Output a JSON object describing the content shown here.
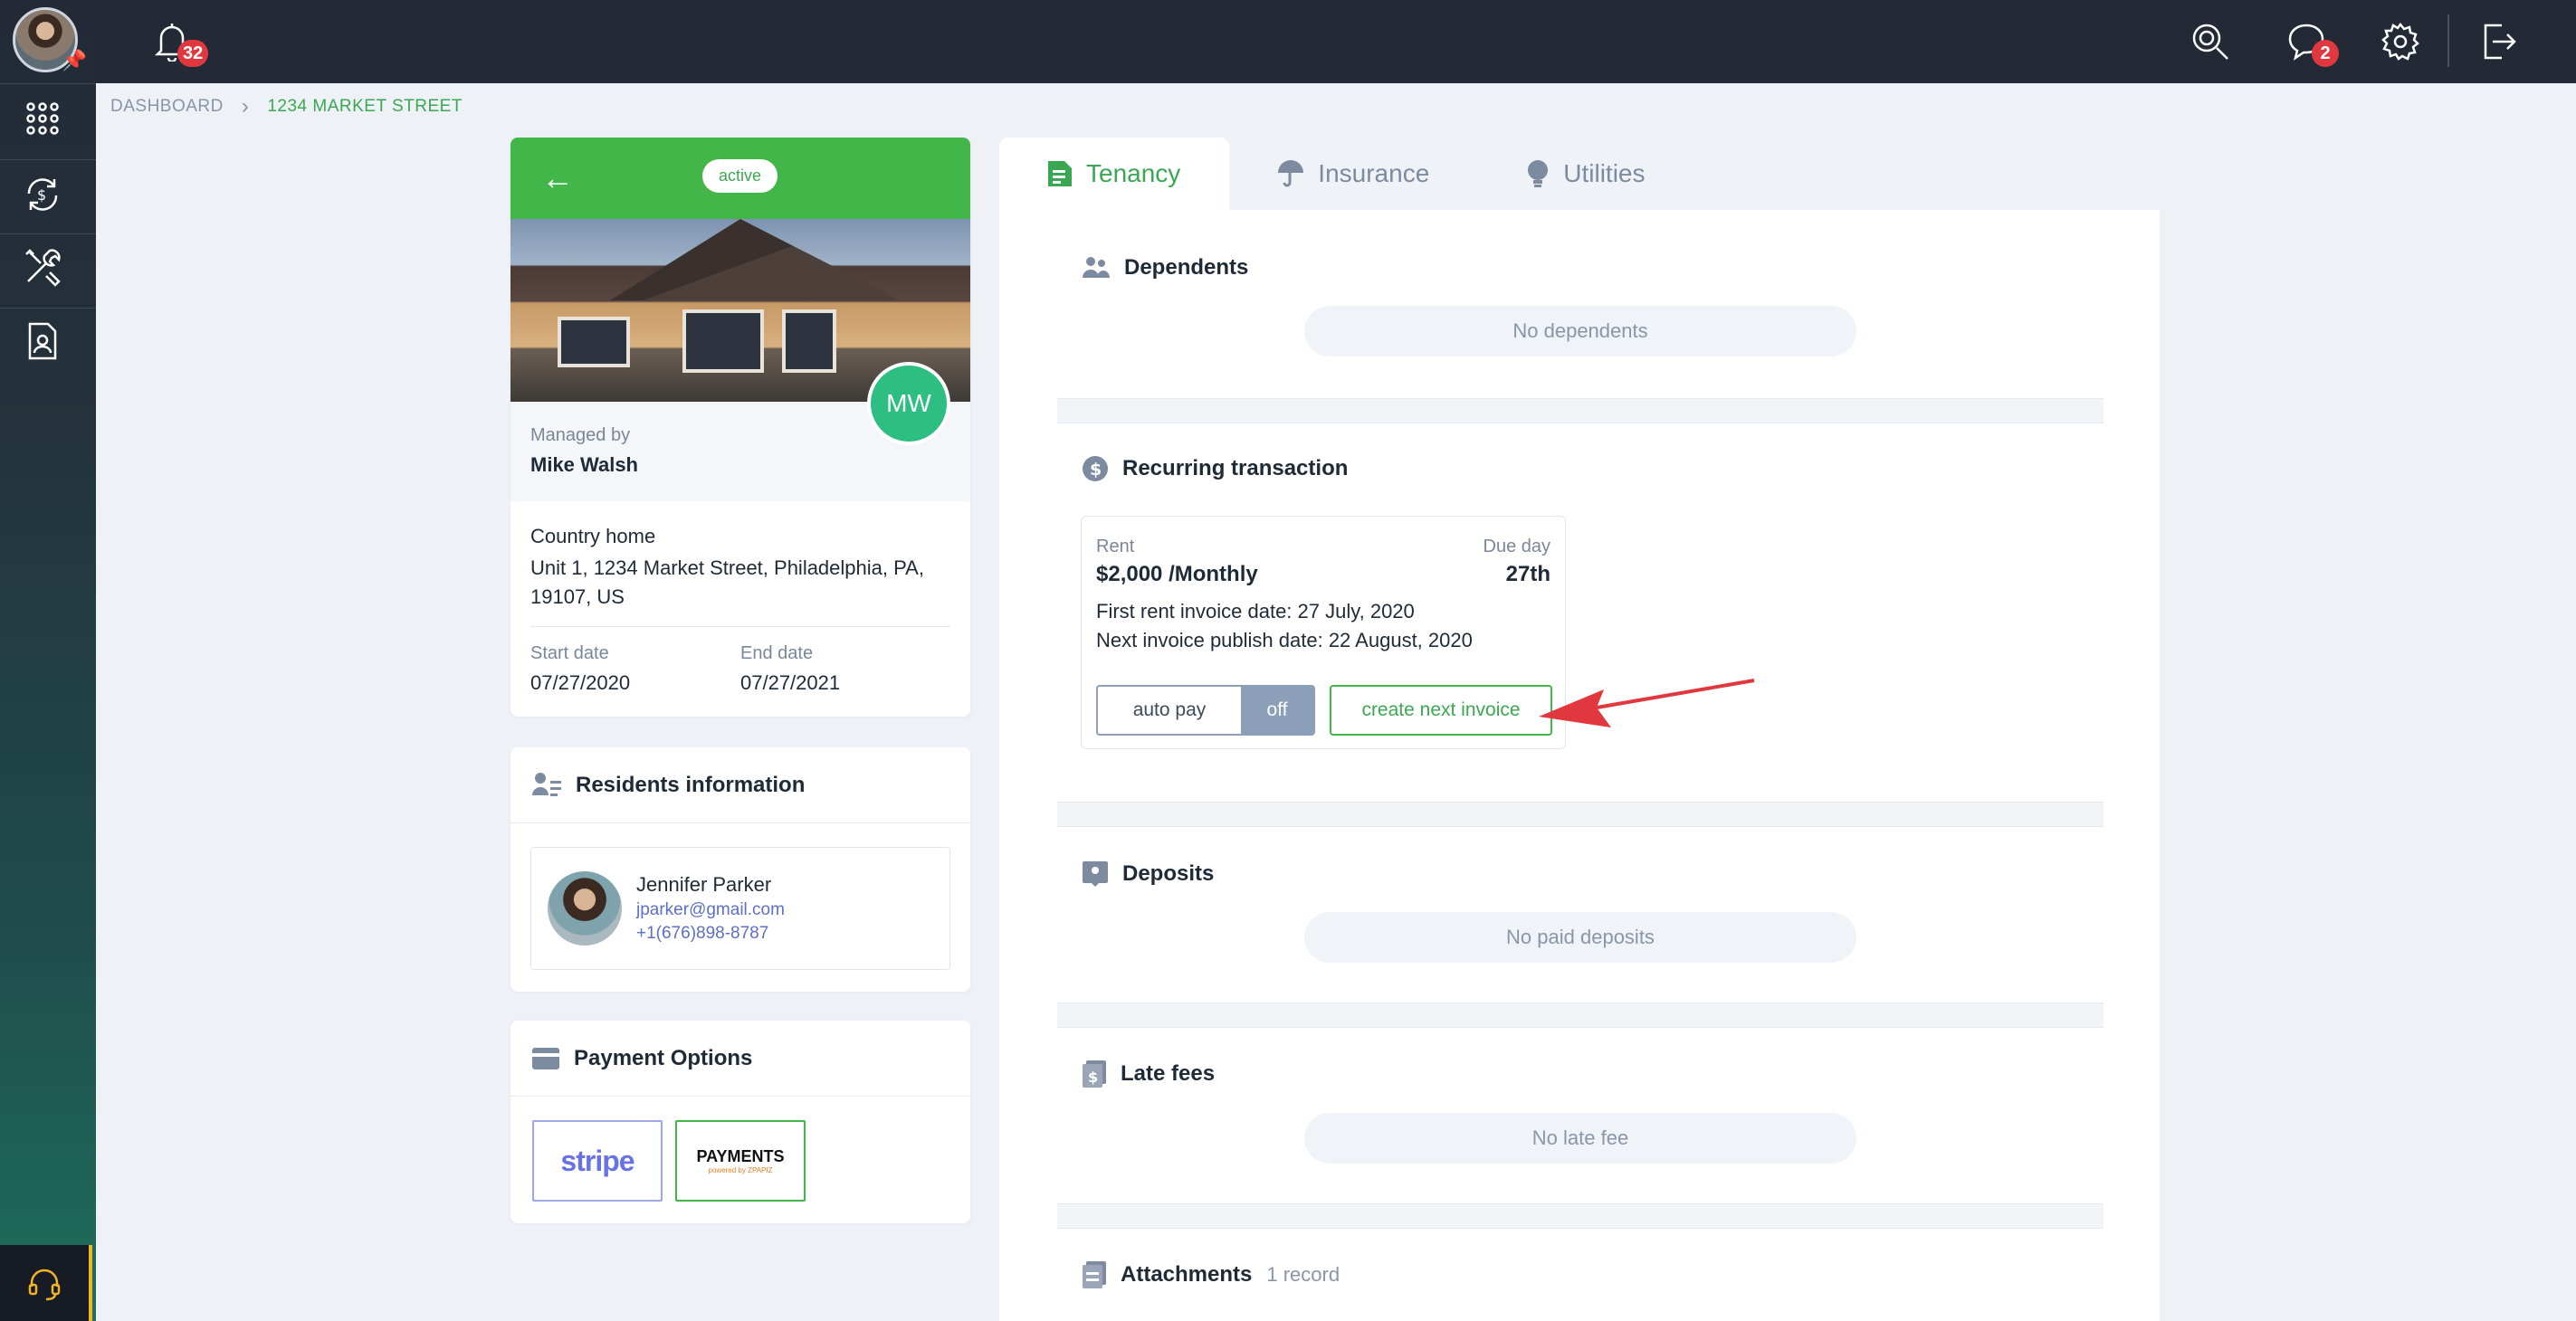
{
  "topbar": {
    "notifications_count": "32",
    "messages_count": "2"
  },
  "breadcrumb": {
    "root": "DASHBOARD",
    "current": "1234 MARKET STREET"
  },
  "property": {
    "status": "active",
    "manager_initials": "MW",
    "managed_by_label": "Managed by",
    "manager_name": "Mike Walsh",
    "name": "Country home",
    "address": "Unit 1, 1234 Market Street, Philadelphia, PA, 19107, US",
    "start_label": "Start date",
    "start_date": "07/27/2020",
    "end_label": "End date",
    "end_date": "07/27/2021"
  },
  "residents": {
    "title": "Residents information",
    "items": [
      {
        "name": "Jennifer Parker",
        "email": "jparker@gmail.com",
        "phone": "+1(676)898-8787"
      }
    ]
  },
  "payment": {
    "title": "Payment Options",
    "stripe_label": "stripe",
    "payments_label": "PAYMENTS",
    "payments_sub": "powered by ZPAPIZ"
  },
  "tabs": [
    {
      "label": "Tenancy",
      "active": true
    },
    {
      "label": "Insurance",
      "active": false
    },
    {
      "label": "Utilities",
      "active": false
    }
  ],
  "dependents": {
    "title": "Dependents",
    "empty": "No dependents"
  },
  "recurring": {
    "title": "Recurring transaction",
    "rent_label": "Rent",
    "due_label": "Due day",
    "amount": "$2,000 /Monthly",
    "due_day": "27th",
    "first_invoice": "First rent invoice date: 27 July, 2020",
    "next_publish": "Next invoice publish date: 22 August, 2020",
    "autopay_label": "auto pay",
    "autopay_state": "off",
    "create_next_label": "create next invoice"
  },
  "deposits": {
    "title": "Deposits",
    "empty": "No paid deposits"
  },
  "late_fees": {
    "title": "Late fees",
    "empty": "No late fee"
  },
  "attachments": {
    "title": "Attachments",
    "count": "1 record"
  },
  "colors": {
    "brand_green": "#43b649",
    "dark_bar": "#232a36",
    "badge_red": "#e0383e",
    "annotation_red": "#e0383e"
  }
}
